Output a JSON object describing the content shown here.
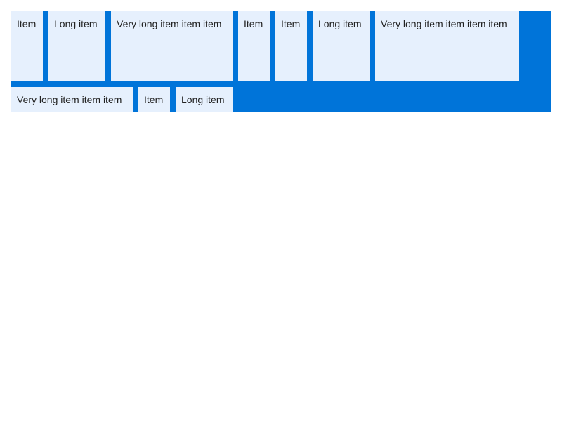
{
  "colors": {
    "container": "#0074d9",
    "item_background": "#e6f0fd",
    "item_text": "#222222"
  },
  "rows": [
    {
      "items": [
        {
          "label": "Item"
        },
        {
          "label": "Long item"
        },
        {
          "label": "Very long item item item"
        },
        {
          "label": "Item"
        },
        {
          "label": "Item"
        },
        {
          "label": "Long item"
        },
        {
          "label": "Very long item item item item"
        }
      ]
    },
    {
      "items": [
        {
          "label": "Very long item item item"
        },
        {
          "label": "Item"
        },
        {
          "label": "Long item"
        }
      ]
    }
  ]
}
